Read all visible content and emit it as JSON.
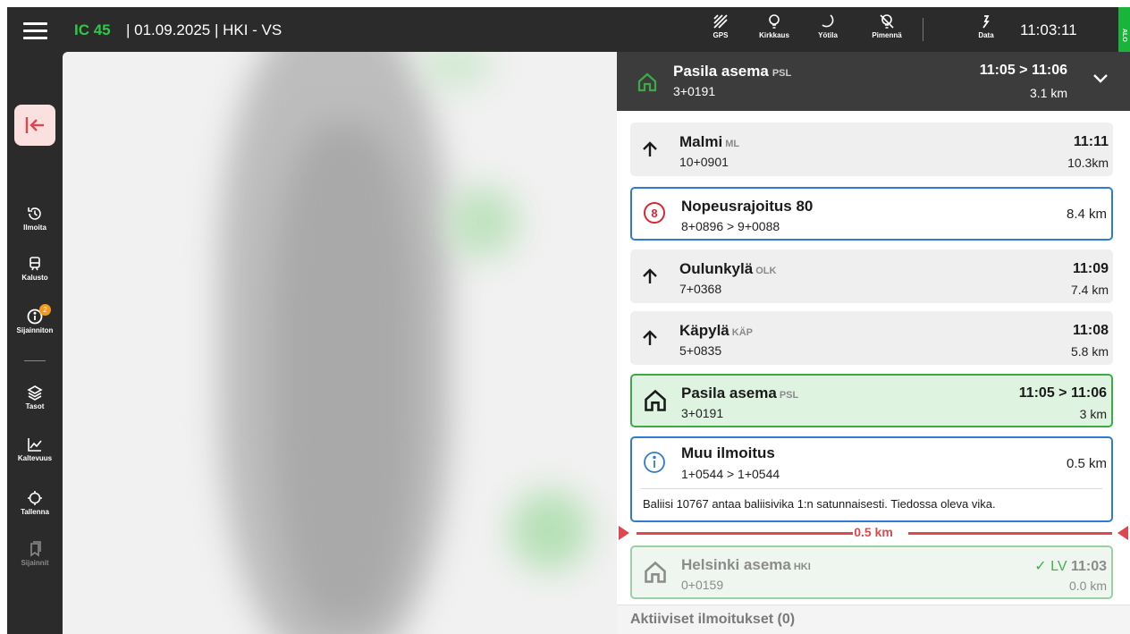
{
  "header": {
    "train_id": "IC 45",
    "trip_info": "| 01.09.2025 | HKI - VS",
    "buttons": {
      "gps": "GPS",
      "brightness": "Kirkkaus",
      "night_mode": "Yötila",
      "dim": "Pimennä",
      "data": "Data"
    },
    "clock": "11:03:11",
    "status_tag": "ALO"
  },
  "sidebar": {
    "items": [
      {
        "label": "Ilmoita",
        "icon": "history-icon"
      },
      {
        "label": "Kalusto",
        "icon": "train-icon"
      },
      {
        "label": "Sijainniton",
        "icon": "info-icon",
        "badge": "2"
      },
      {
        "label": "Tasot",
        "icon": "layers-icon"
      },
      {
        "label": "Kaltevuus",
        "icon": "chart-icon"
      },
      {
        "label": "Tallenna",
        "icon": "crosshair-icon"
      },
      {
        "label": "Sijainnit",
        "icon": "bookmark-icon"
      }
    ]
  },
  "current_stop": {
    "name": "Pasila asema",
    "code": "PSL",
    "position": "3+0191",
    "time": "11:05 > 11:06",
    "distance": "3.1 km"
  },
  "events": [
    {
      "type": "station",
      "name": "Malmi",
      "code": "ML",
      "position": "10+0901",
      "time": "11:11",
      "distance": "10.3km"
    },
    {
      "type": "speed_limit",
      "limit": "8",
      "name": "Nopeusrajoitus 80",
      "position": "8+0896 > 9+0088",
      "distance": "8.4 km"
    },
    {
      "type": "station",
      "name": "Oulunkylä",
      "code": "OLK",
      "position": "7+0368",
      "time": "11:09",
      "distance": "7.4 km"
    },
    {
      "type": "station",
      "name": "Käpylä",
      "code": "KÄP",
      "position": "5+0835",
      "time": "11:08",
      "distance": "5.8 km"
    },
    {
      "type": "stop",
      "name": "Pasila asema",
      "code": "PSL",
      "position": "3+0191",
      "time": "11:05 > 11:06",
      "distance": "3 km"
    },
    {
      "type": "notice",
      "name": "Muu ilmoitus",
      "position": "1+0544 > 1+0544",
      "distance": "0.5 km",
      "note": "Baliisi 10767 antaa baliisivika 1:n satunnaisesti. Tiedossa oleva vika."
    },
    {
      "type": "passed_stop",
      "name": "Helsinki asema",
      "code": "HKI",
      "position": "0+0159",
      "status": "✓ LV",
      "time": "11:03",
      "distance": "0.0 km"
    }
  ],
  "distance_marker": "0.5 km",
  "active_notices": "Aktiiviset ilmoitukset (0)",
  "colors": {
    "accent_green": "#2ec84a",
    "danger_red": "#e0464d",
    "info_blue": "#2f7ccf",
    "dark_bg": "#2b2b2b"
  }
}
